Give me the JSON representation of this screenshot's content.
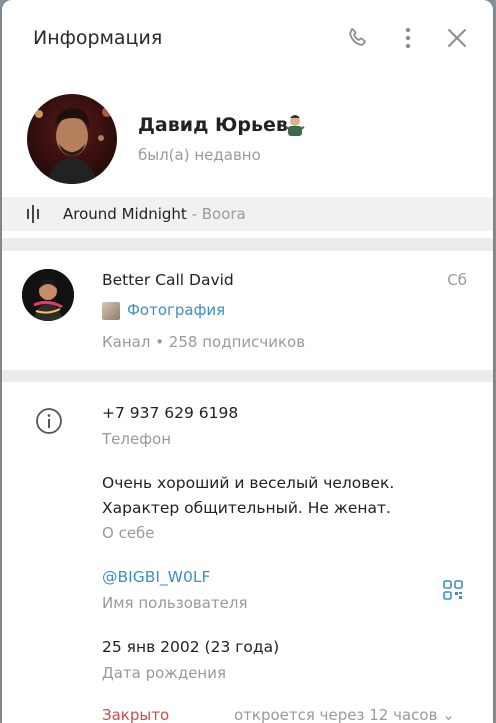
{
  "header": {
    "title": "Информация",
    "icons": [
      "phone-icon",
      "more-vertical-icon",
      "close-icon"
    ]
  },
  "profile": {
    "name": "Давид Юрьев",
    "status": "был(а) недавно"
  },
  "music": {
    "track": "Around Midnight",
    "separator": " - ",
    "artist": "Boora"
  },
  "channel": {
    "name": "Better Call David",
    "day": "Сб",
    "preview": "Фотография",
    "meta": "Канал • 258 подписчиков"
  },
  "info": {
    "phone": "+7 937 629 6198",
    "phone_label": "Телефон",
    "bio_line1": "Очень хороший и веселый человек.",
    "bio_line2": "Характер общительный. Не женат.",
    "bio_label": "О себе",
    "username": "@BIGBI_W0LF",
    "username_label": "Имя пользователя",
    "birthday": "25 янв 2002 (23 года)",
    "birthday_label": "Дата рождения",
    "hours_status": "Закрыто",
    "hours_note": "откроется через 12 часов"
  },
  "colors": {
    "accent": "#3d8ec7",
    "closed": "#d04a4a",
    "muted": "#9a9a9a"
  }
}
